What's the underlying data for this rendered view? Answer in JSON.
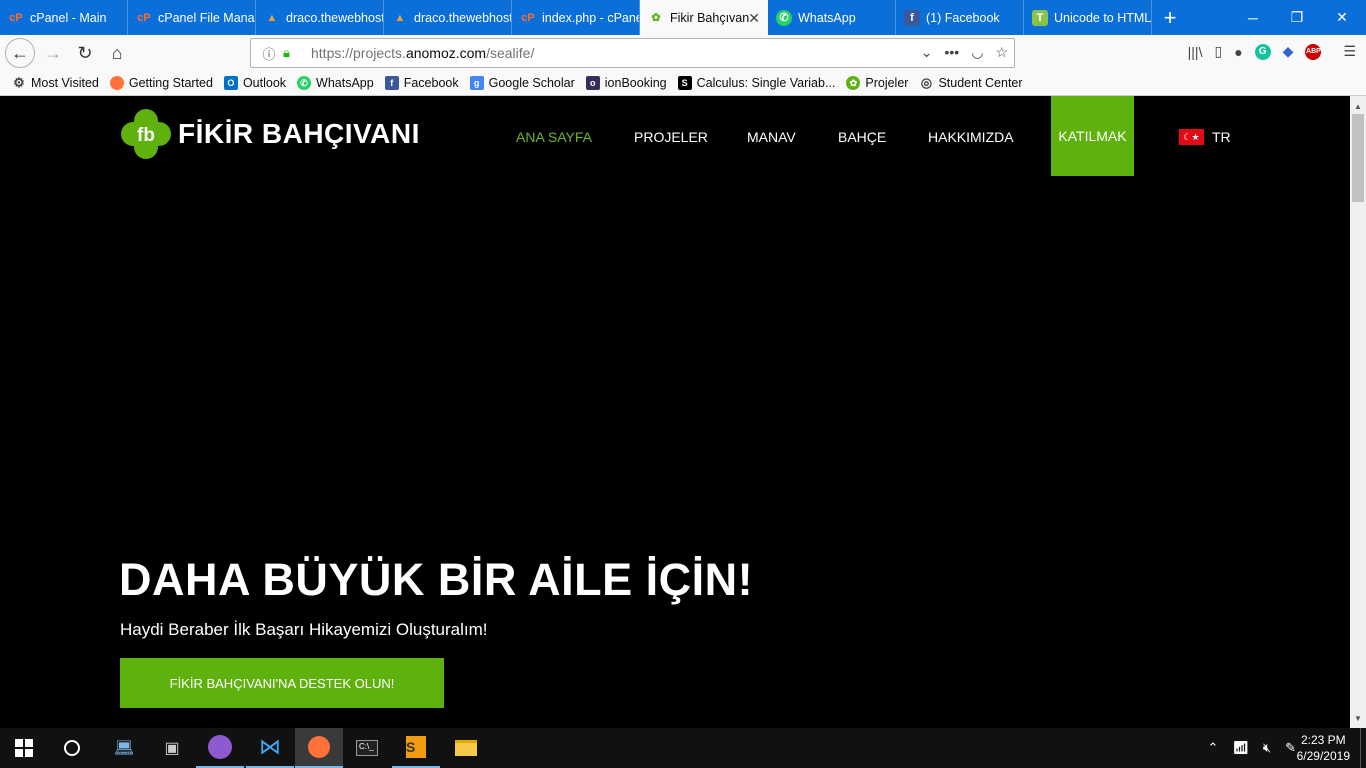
{
  "tabs": [
    {
      "label": "cPanel - Main",
      "icon": "cpanel-icon"
    },
    {
      "label": "cPanel File Manager",
      "icon": "cpanel-icon"
    },
    {
      "label": "draco.thewebhost",
      "icon": "hosting-icon"
    },
    {
      "label": "draco.thewebhost",
      "icon": "hosting-icon"
    },
    {
      "label": "index.php - cPanel",
      "icon": "cpanel-icon"
    },
    {
      "label": "Fikir Bahçıvanı",
      "icon": "fb-icon",
      "active": true
    },
    {
      "label": "WhatsApp",
      "icon": "whatsapp-icon"
    },
    {
      "label": "(1) Facebook",
      "icon": "facebook-icon"
    },
    {
      "label": "Unicode to HTML",
      "icon": "t-icon"
    }
  ],
  "browser": {
    "url_prefix": "https://projects.",
    "url_domain": "anomoz.com",
    "url_path": "/sealife/"
  },
  "bookmarks": [
    {
      "label": "Most Visited",
      "icon": "gear-icon"
    },
    {
      "label": "Getting Started",
      "icon": "firefox-icon"
    },
    {
      "label": "Outlook",
      "icon": "outlook-icon"
    },
    {
      "label": "WhatsApp",
      "icon": "whatsapp-icon"
    },
    {
      "label": "Facebook",
      "icon": "facebook-icon"
    },
    {
      "label": "Google Scholar",
      "icon": "scholar-icon"
    },
    {
      "label": "ionBooking",
      "icon": "ion-icon"
    },
    {
      "label": "Calculus: Single Variab...",
      "icon": "s-icon"
    },
    {
      "label": "Projeler",
      "icon": "fb-icon"
    },
    {
      "label": "Student Center",
      "icon": "globe-icon"
    }
  ],
  "site": {
    "logo_text": "FİKİR BAHÇIVANI",
    "menu": [
      "ANA SAYFA",
      "PROJELER",
      "MANAV",
      "BAHÇE",
      "HAKKIMIZDA"
    ],
    "join": "KATILMAK",
    "lang": "TR",
    "hero_title": "DAHA BÜYÜK BİR AİLE İÇİN!",
    "hero_subtitle": "Haydi Beraber İlk Başarı Hikayemizi Oluşturalım!",
    "cta": "FİKİR BAHÇIVANI'NA DESTEK OLUN!"
  },
  "clock": {
    "time": "2:23 PM",
    "date": "6/29/2019"
  },
  "colors": {
    "brand_green": "#5fb20e",
    "active_menu": "#6db522",
    "tab_bar": "#0a6fd8"
  }
}
